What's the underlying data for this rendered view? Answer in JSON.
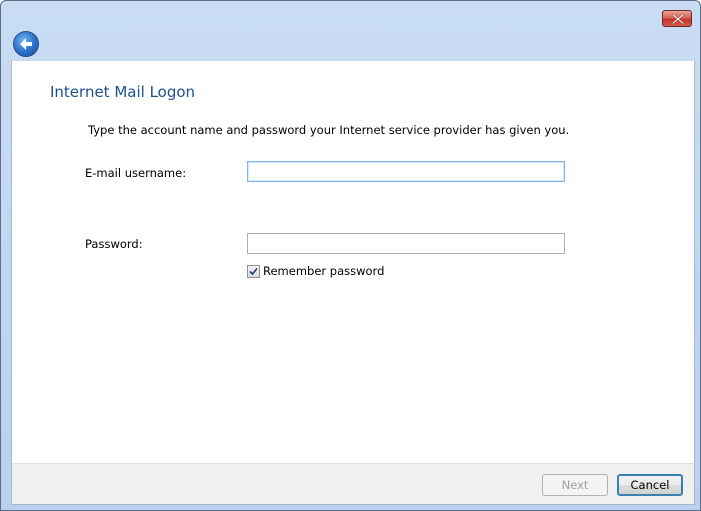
{
  "window": {
    "title": "",
    "close_icon": "close-icon",
    "back_icon": "back-arrow-icon"
  },
  "page": {
    "title": "Internet Mail Logon",
    "instruction": "Type the account name and password your Internet service provider has given you."
  },
  "form": {
    "username_label": "E-mail username:",
    "username_value": "",
    "password_label": "Password:",
    "password_value": "",
    "remember_label": "Remember password",
    "remember_checked": true
  },
  "buttons": {
    "next_label": "Next",
    "cancel_label": "Cancel"
  },
  "colors": {
    "title_blue": "#1d4f91",
    "frame_blue": "#b9d1ee"
  }
}
